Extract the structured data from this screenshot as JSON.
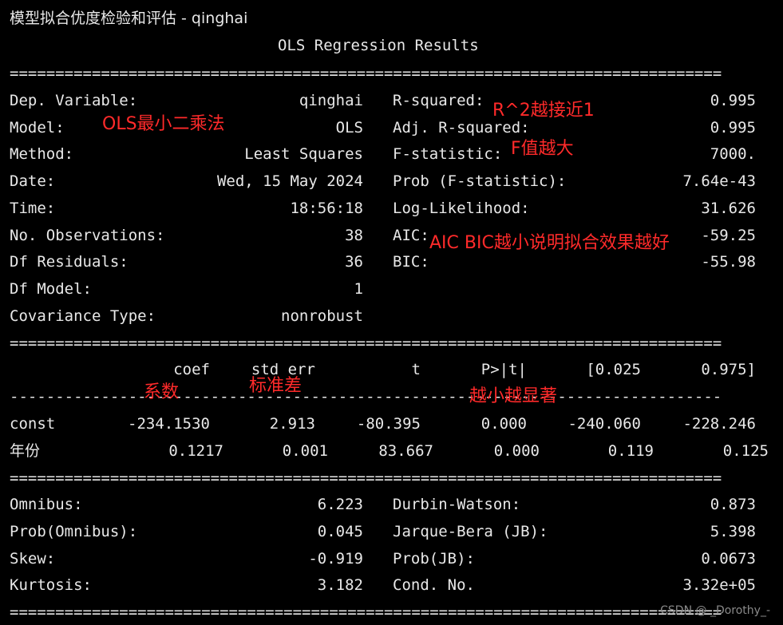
{
  "title_line": "模型拟合优度检验和评估 - qinghai",
  "header": "OLS Regression Results",
  "separator_eq": "==============================================================================",
  "separator_dash": "------------------------------------------------------------------------------",
  "summary_left": [
    {
      "label": "Dep. Variable:",
      "value": "qinghai"
    },
    {
      "label": "Model:",
      "value": "OLS"
    },
    {
      "label": "Method:",
      "value": "Least Squares"
    },
    {
      "label": "Date:",
      "value": "Wed, 15 May 2024"
    },
    {
      "label": "Time:",
      "value": "18:56:18"
    },
    {
      "label": "No. Observations:",
      "value": "38"
    },
    {
      "label": "Df Residuals:",
      "value": "36"
    },
    {
      "label": "Df Model:",
      "value": "1"
    },
    {
      "label": "Covariance Type:",
      "value": "nonrobust"
    }
  ],
  "summary_right": [
    {
      "label": "R-squared:",
      "value": "0.995"
    },
    {
      "label": "Adj. R-squared:",
      "value": "0.995"
    },
    {
      "label": "F-statistic:",
      "value": "7000."
    },
    {
      "label": "Prob (F-statistic):",
      "value": "7.64e-43"
    },
    {
      "label": "Log-Likelihood:",
      "value": "31.626"
    },
    {
      "label": "AIC:",
      "value": "-59.25"
    },
    {
      "label": "BIC:",
      "value": "-55.98"
    }
  ],
  "coef_headers": [
    "coef",
    "std err",
    "t",
    "P>|t|",
    "[0.025",
    "0.975]"
  ],
  "coef_rows": [
    {
      "name": "const",
      "values": [
        "-234.1530",
        "2.913",
        "-80.395",
        "0.000",
        "-240.060",
        "-228.246"
      ]
    },
    {
      "name": "年份",
      "values": [
        "0.1217",
        "0.001",
        "83.667",
        "0.000",
        "0.119",
        "0.125"
      ]
    }
  ],
  "diag_left": [
    {
      "label": "Omnibus:",
      "value": "6.223"
    },
    {
      "label": "Prob(Omnibus):",
      "value": "0.045"
    },
    {
      "label": "Skew:",
      "value": "-0.919"
    },
    {
      "label": "Kurtosis:",
      "value": "3.182"
    }
  ],
  "diag_right": [
    {
      "label": "Durbin-Watson:",
      "value": "0.873"
    },
    {
      "label": "Jarque-Bera (JB):",
      "value": "5.398"
    },
    {
      "label": "Prob(JB):",
      "value": "0.0673"
    },
    {
      "label": "Cond. No.",
      "value": "3.32e+05"
    }
  ],
  "annotations": {
    "ols": "OLS最小二乘法",
    "r2": "R^2越接近1",
    "f": "F值越大",
    "aic": "AIC BIC越小说明拟合效果越好",
    "coef": "系数",
    "stderr": "标准差",
    "pvalue": "越小越显著"
  },
  "watermark": "CSDN @ _Dorothy_-",
  "colors": {
    "background": "#000000",
    "text": "#e8e8e8",
    "annotation": "#ff2a2a"
  }
}
